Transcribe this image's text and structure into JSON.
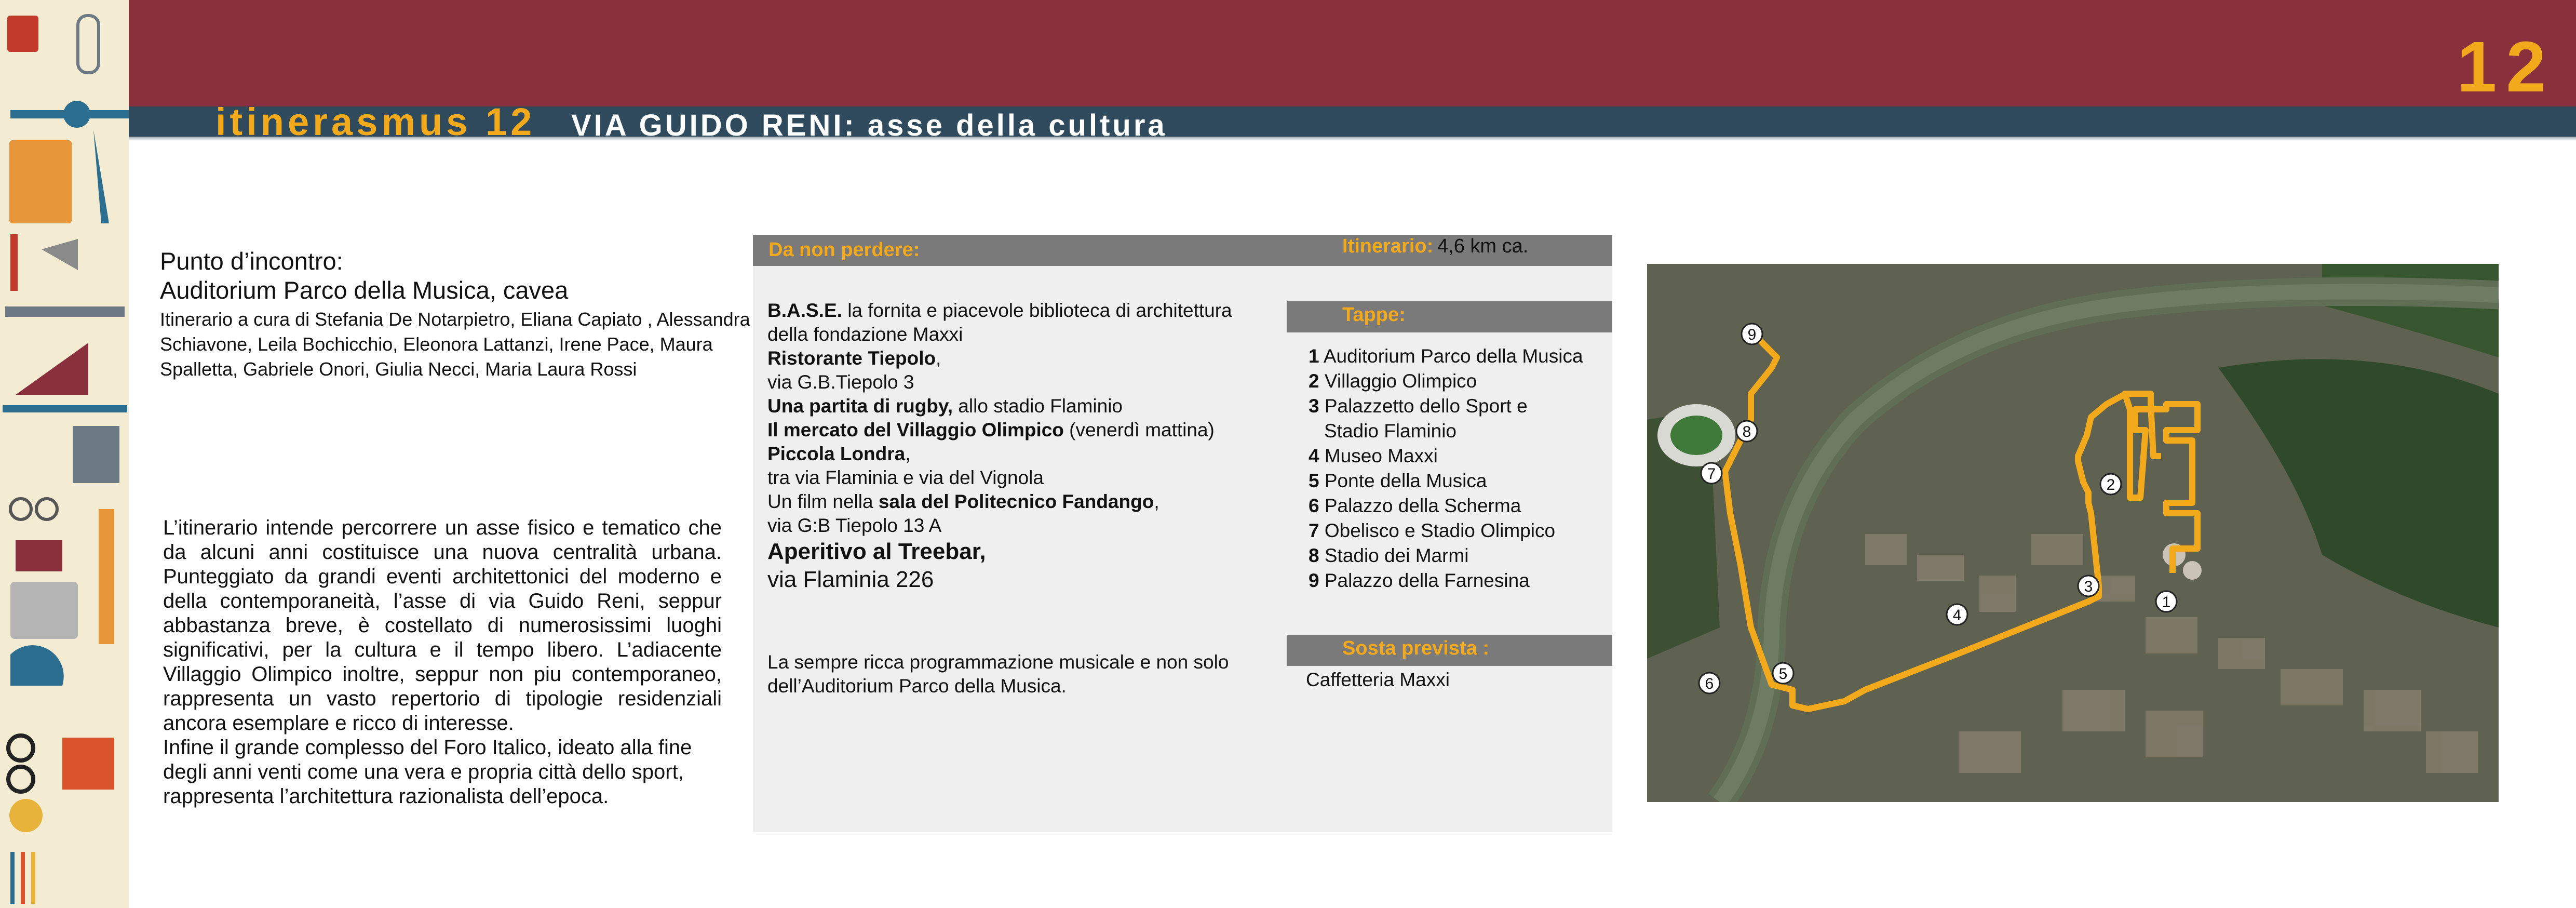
{
  "header": {
    "number": "12",
    "brand": "itinerasmus 12",
    "title": "VIA GUIDO RENI: asse della cultura"
  },
  "meeting": {
    "label": "Punto d’incontro:",
    "place": "Auditorium Parco della Musica, cavea",
    "curators": "Itinerario a cura di Stefania De Notarpietro, Eliana Capiato , Alessandra Schiavone, Leila Bochicchio, Eleonora Lattanzi, Irene Pace, Maura Spalletta, Gabriele Onori, Giulia Necci, Maria Laura Rossi"
  },
  "description": {
    "paragraph1": "L’itinerario intende percorrere un asse fisico e tematico che da alcuni anni costituisce una nuova centralità urbana. Punteggiato da grandi eventi architettonici del moderno e della contemporaneità, l’asse di via Guido Reni, seppur abbastanza breve, è costellato di numerosissimi luoghi significativi, per la cultura e il tempo libero. L’adiacente Villaggio Olimpico inoltre, seppur non piu contemporaneo, rappresenta un vasto repertorio di tipologie residenziali ancora esemplare e ricco di interesse.",
    "paragraph2": "Infine il grande complesso del Foro Italico, ideato alla fine degli anni venti come una vera e propria città dello sport, rappresenta l’architettura razionalista dell’epoca."
  },
  "panel": {
    "da_non_perdere": "Da non perdere:",
    "itinerario_label": "Itinerario:",
    "itinerario_value": "4,6 km ca.",
    "places": {
      "base_name": "B.A.S.E.",
      "base_text": " la fornita e piacevole biblioteca di architettura della fondazione Maxxi",
      "tiepolo_name": "Ristorante Tiepolo",
      "tiepolo_comma": ",",
      "tiepolo_address": "via G.B.Tiepolo 3",
      "rugby_name": "Una partita di rugby,",
      "rugby_text": " allo stadio Flaminio",
      "mercato_name": "Il mercato del Villaggio Olimpico",
      "mercato_text": " (venerdì mattina)",
      "londra_name": "Piccola Londra",
      "londra_comma": ",",
      "londra_address": "tra via Flaminia e via del Vignola",
      "film_prefix": "Un film nella ",
      "film_name": "sala del Politecnico Fandango",
      "film_comma": ",",
      "film_address": "via G:B Tiepolo 13 A",
      "aperitivo_name": "Aperitivo al Treebar,",
      "aperitivo_address": "via Flaminia 226"
    },
    "music_note": "La sempre ricca programmazione musicale e non solo dell’Auditorium Parco della Musica.",
    "tappe_label": "Tappe:",
    "stops": [
      {
        "num": "1",
        "name": "Auditorium Parco della Musica"
      },
      {
        "num": "2",
        "name": "Villaggio Olimpico"
      },
      {
        "num": "3",
        "name": "Palazzetto dello Sport e",
        "name2": "Stadio Flaminio"
      },
      {
        "num": "4",
        "name": "Museo Maxxi"
      },
      {
        "num": "5",
        "name": "Ponte della Musica"
      },
      {
        "num": "6",
        "name": "Palazzo della Scherma"
      },
      {
        "num": "7",
        "name": "Obelisco e Stadio Olimpico"
      },
      {
        "num": "8",
        "name": "Stadio dei Marmi"
      },
      {
        "num": "9",
        "name": "Palazzo della Farnesina"
      }
    ],
    "sosta_label": "Sosta prevista :",
    "sosta_value": "Caffetteria Maxxi"
  },
  "map": {
    "markers": [
      "1",
      "2",
      "3",
      "4",
      "5",
      "6",
      "7",
      "8",
      "9"
    ],
    "route_color": "#f2a91c",
    "river_color": "#5f6e55",
    "vegetation_color": "#2f4a2a"
  },
  "colors": {
    "header": "#8a2f3c",
    "subheader": "#2e4a5c",
    "accent": "#f2a91c",
    "panel_bar": "#7a7a7a",
    "panel_bg": "#efefef"
  }
}
